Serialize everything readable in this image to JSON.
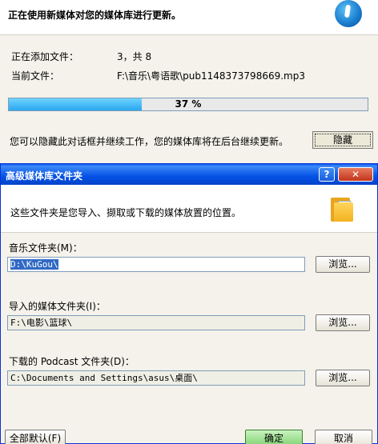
{
  "progress_window": {
    "title": "正在使用新媒体对您的媒体库进行更新。",
    "adding_label": "正在添加文件：",
    "adding_value": "3，共 8",
    "current_label": "当前文件：",
    "current_value": "F:\\音乐\\粤语歌\\pub1148373798669.mp3",
    "progress_percent": 37,
    "progress_text": "37 %",
    "hint": "您可以隐藏此对话框并继续工作，您的媒体库将在后台继续更新。",
    "hide_button": "隐藏"
  },
  "dialog": {
    "title": "高级媒体库文件夹",
    "help_label": "?",
    "close_label": "✕",
    "intro": "这些文件夹是您导入、撷取或下载的媒体放置的位置。",
    "fields": [
      {
        "label": "音乐文件夹(M)：",
        "value": "D:\\KuGou\\",
        "browse": "浏览..."
      },
      {
        "label": "导入的媒体文件夹(I)：",
        "value": "F:\\电影\\篮球\\",
        "browse": "浏览..."
      },
      {
        "label": "下载的 Podcast 文件夹(D)：",
        "value": "C:\\Documents and Settings\\asus\\桌面\\",
        "browse": "浏览..."
      }
    ],
    "default_button": "全部默认(F)",
    "ok_button": "确定",
    "cancel_button": "取消"
  }
}
